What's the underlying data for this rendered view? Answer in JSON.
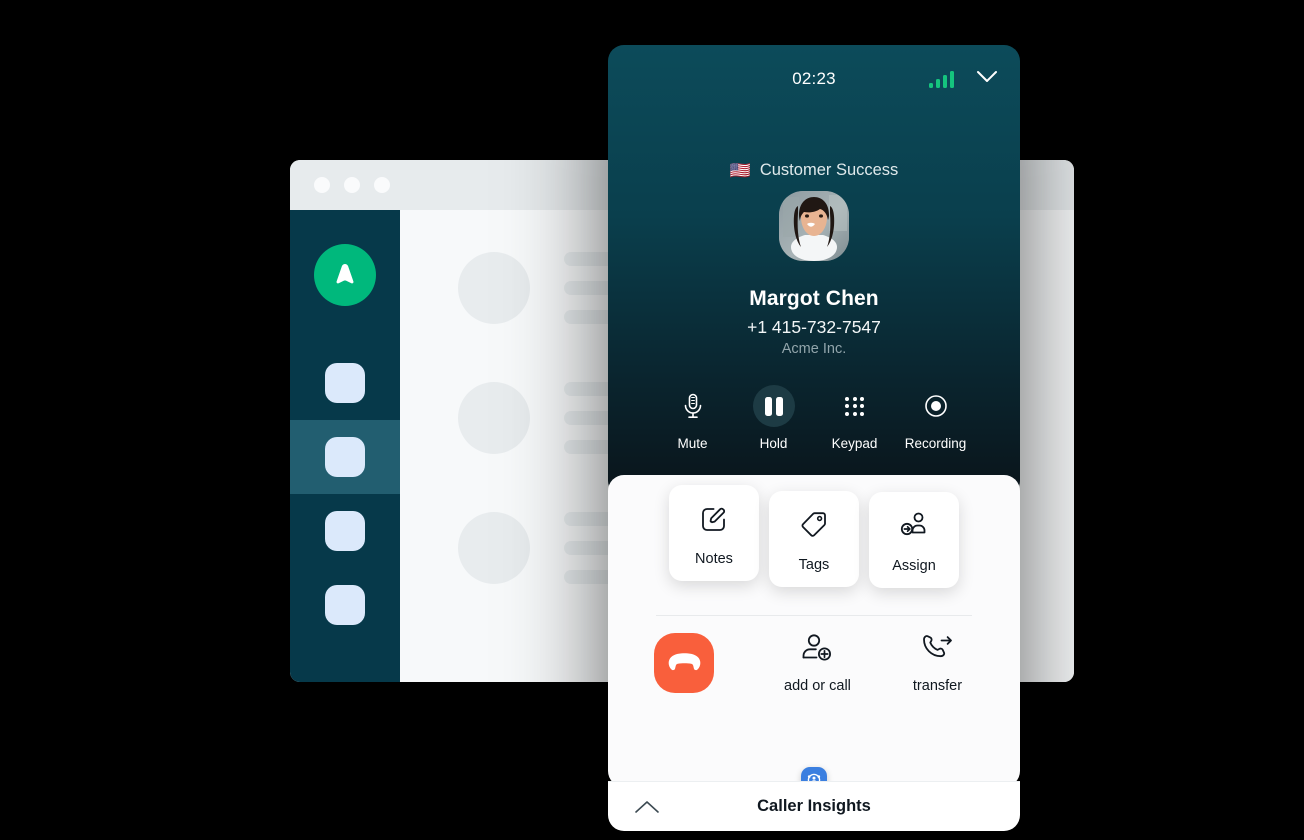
{
  "background_app": {
    "name": "aircall-dashboard-window",
    "titlebar": {
      "dots": [
        "close-dot",
        "minimize-dot",
        "maximize-dot"
      ]
    },
    "sidebar": {
      "logo": "aircall-logo-icon",
      "items": [
        {
          "name": "nav-item-1",
          "icon": "nav-chip-icon",
          "active": false
        },
        {
          "name": "nav-item-2",
          "icon": "nav-chip-icon",
          "active": true
        },
        {
          "name": "nav-item-3",
          "icon": "nav-chip-icon",
          "active": false
        },
        {
          "name": "nav-item-4",
          "icon": "nav-chip-icon",
          "active": false
        }
      ]
    },
    "skeleton_rows": [
      {
        "bars": [
          132,
          150,
          108
        ]
      },
      {
        "bars": [
          132,
          150,
          108
        ]
      },
      {
        "bars": [
          132,
          150,
          108
        ]
      }
    ]
  },
  "call_panel": {
    "status": {
      "timer": "02:23",
      "signal_icon": "signal-bars-icon",
      "signal_bars": 4,
      "collapse_icon": "chevron-down-icon"
    },
    "team": {
      "flag": "🇺🇸",
      "label": "Customer Success"
    },
    "contact": {
      "avatar": "contact-avatar-photo",
      "name": "Margot Chen",
      "phone": "+1 415-732-7547",
      "company": "Acme Inc."
    },
    "controls": [
      {
        "id": "mute",
        "label": "Mute",
        "icon": "microphone-icon",
        "active": false
      },
      {
        "id": "hold",
        "label": "Hold",
        "icon": "pause-icon",
        "active": true
      },
      {
        "id": "keypad",
        "label": "Keypad",
        "icon": "keypad-dots-icon",
        "active": false
      },
      {
        "id": "recording",
        "label": "Recording",
        "icon": "record-circle-icon",
        "active": false
      }
    ],
    "cursor": "pointing-hand-cursor",
    "quick_cards": [
      {
        "id": "notes",
        "label": "Notes",
        "icon": "edit-pencil-square-icon"
      },
      {
        "id": "tags",
        "label": "Tags",
        "icon": "tag-icon"
      },
      {
        "id": "assign",
        "label": "Assign",
        "icon": "assign-user-arrow-icon"
      }
    ],
    "actions": {
      "end_call_icon": "end-call-handset-icon",
      "add_or_call": {
        "label": "add or call",
        "icon": "add-person-icon"
      },
      "transfer": {
        "label": "transfer",
        "icon": "transfer-call-icon"
      }
    },
    "footer": {
      "badge_icon": "caller-insights-badge-icon",
      "expand_icon": "chevron-up-icon",
      "label": "Caller Insights"
    }
  },
  "colors": {
    "brand_green": "#00b87c",
    "panel_top": "#0c4b5a",
    "panel_bottom_dark": "#0a141a",
    "end_call_orange": "#f95f3c",
    "signal_green": "#15c47e",
    "insights_blue": "#3b7fe0",
    "sidebar_dark": "#06394a",
    "sidebar_active": "#225e70",
    "nav_chip_blue": "#dbe9fb",
    "canvas": "#000000"
  }
}
